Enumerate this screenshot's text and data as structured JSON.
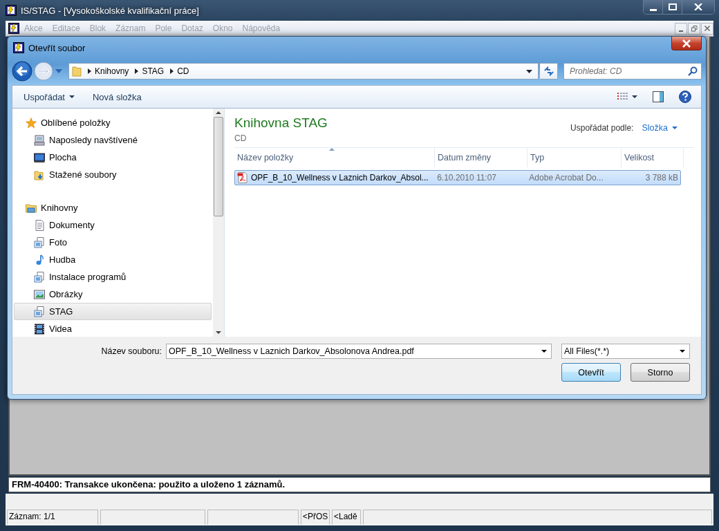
{
  "app": {
    "title": "IS/STAG - [Vysokoškolské kvalifikační práce]",
    "menu": [
      "Akce",
      "Editace",
      "Blok",
      "Záznam",
      "Pole",
      "Dotaz",
      "Okno",
      "Nápověda"
    ]
  },
  "dialog": {
    "title": "Otevřít soubor",
    "breadcrumb": [
      "Knihovny",
      "STAG",
      "CD"
    ],
    "search": {
      "placeholder": "Prohledat: CD"
    },
    "toolbar": [
      "Uspořádat",
      "Nová složka"
    ],
    "nav": [
      {
        "label": "Oblíbené položky",
        "kind": "star",
        "selected": false,
        "children": [
          {
            "label": "Naposledy navštívené",
            "kind": "recent",
            "selected": false
          },
          {
            "label": "Plocha",
            "kind": "desktop",
            "selected": false
          },
          {
            "label": "Stažené soubory",
            "kind": "downloads",
            "selected": false
          }
        ]
      },
      {
        "label": "Knihovny",
        "kind": "libraries",
        "selected": false,
        "children": [
          {
            "label": "Dokumenty",
            "kind": "documents",
            "selected": false
          },
          {
            "label": "Foto",
            "kind": "library",
            "selected": false
          },
          {
            "label": "Hudba",
            "kind": "music",
            "selected": false
          },
          {
            "label": "Instalace programů",
            "kind": "library",
            "selected": false
          },
          {
            "label": "Obrázky",
            "kind": "images",
            "selected": false
          },
          {
            "label": "STAG",
            "kind": "library",
            "selected": true
          },
          {
            "label": "Videa",
            "kind": "video",
            "selected": false
          }
        ]
      }
    ],
    "library": {
      "title": "Knihovna STAG",
      "subtitle": "CD",
      "arrange_label": "Uspořádat podle:",
      "arrange_value": "Složka"
    },
    "columns": [
      {
        "label": "Název položky",
        "sorted": true
      },
      {
        "label": "Datum změny"
      },
      {
        "label": "Typ"
      },
      {
        "label": "Velikost"
      }
    ],
    "files": [
      {
        "name": "OPF_B_10_Wellness v Laznich Darkov_Absol...",
        "modified": "6.10.2010 11:07",
        "type": "Adobe Acrobat Do...",
        "size": "3 788 kB",
        "selected": true
      }
    ],
    "filename": {
      "label": "Název souboru:",
      "value": "OPF_B_10_Wellness v Laznich Darkov_Absolonova Andrea.pdf"
    },
    "filter": "All Files(*.*)",
    "buttons": [
      {
        "label": "Otevřít",
        "default": true
      },
      {
        "label": "Storno",
        "default": false
      }
    ]
  },
  "message": "FRM-40400: Transakce ukončena: použito a uloženo 1 záznamů.",
  "status_bar": {
    "record": "Záznam: 1/1",
    "mode_1": "<PřOS",
    "mode_2": "<Ladě"
  }
}
